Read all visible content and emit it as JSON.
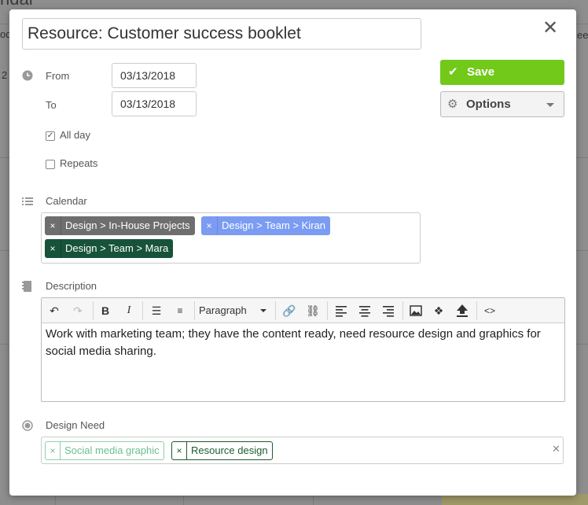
{
  "background": {
    "header_fragment": "ndar",
    "left_fragment_1": "od",
    "left_fragment_2": "2",
    "right_fragment": "eek"
  },
  "modal": {
    "title": "Resource: Customer success booklet",
    "close_glyph": "✕",
    "from_label": "From",
    "from_value": "03/13/2018",
    "to_label": "To",
    "to_value": "03/13/2018",
    "all_day_label": "All day",
    "all_day_checked": true,
    "repeats_label": "Repeats",
    "repeats_checked": false,
    "save_label": "Save",
    "options_label": "Options",
    "calendar_label": "Calendar",
    "calendars": [
      {
        "label": "Design > In-House Projects",
        "color": "#6e6e6e"
      },
      {
        "label": "Design > Team > Kiran",
        "color": "#7b9cf2"
      },
      {
        "label": "Design > Team > Mara",
        "color": "#17533a"
      }
    ],
    "description_label": "Description",
    "toolbar": {
      "format_label": "Paragraph",
      "icons": [
        "undo-icon",
        "redo-icon",
        "bold-icon",
        "italic-icon",
        "bullet-list-icon",
        "numbered-list-icon",
        "link-icon",
        "unlink-icon",
        "align-left-icon",
        "align-center-icon",
        "align-right-icon",
        "image-icon",
        "dropbox-icon",
        "upload-icon",
        "code-icon"
      ]
    },
    "description_text": "Work with marketing team; they have the content ready, need resource design and graphics for social media sharing.",
    "design_need_label": "Design Need",
    "design_needs": [
      {
        "label": "Social media graphic",
        "color": "#8fd0a8",
        "text_color": "#6cbf8d"
      },
      {
        "label": "Resource design",
        "color": "#1d5c2e",
        "text_color": "#1d5c2e"
      }
    ],
    "tag_remove_glyph": "×",
    "colors": {
      "save": "#72c919"
    }
  }
}
